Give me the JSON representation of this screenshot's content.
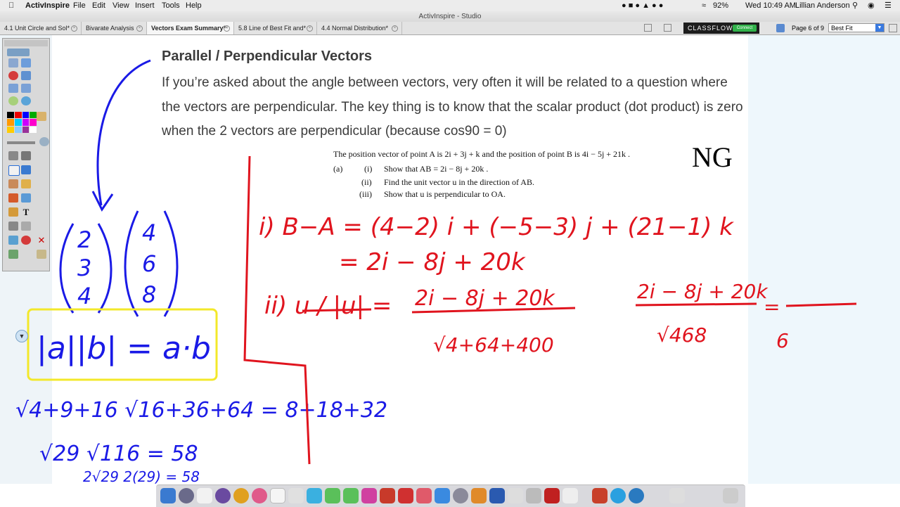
{
  "menubar": {
    "apple": "",
    "app_name": "ActivInspire",
    "items": [
      "File",
      "Edit",
      "View",
      "Insert",
      "Tools",
      "Help"
    ],
    "battery": "92%",
    "clock": "Wed 10:49 AM",
    "user": "Lillian Anderson"
  },
  "window": {
    "title": "ActivInspire - Studio"
  },
  "tabs": [
    {
      "label": "4.1 Unit Circle and Sol*"
    },
    {
      "label": "Bivarate Analysis"
    },
    {
      "label": "Vectors Exam Summary*"
    },
    {
      "label": "5.8 Line of Best Fit and*"
    },
    {
      "label": "4.4 Normal Distribution*"
    }
  ],
  "toolbar": {
    "classflow": "CLASSFLOW",
    "connect": "Connect",
    "page_indicator": "Page 6 of 9",
    "zoom": "Best Fit"
  },
  "content": {
    "heading": "Parallel / Perpendicular Vectors",
    "paragraph": "If you’re asked about the angle between vectors, very often it will be related to a question where the vectors are perpendicular. The key thing is to know that the scalar product (dot product) is zero when the 2 vectors are perpendicular (because cos90 = 0)",
    "question": {
      "intro": "The position vector of point A is 2i + 3j + k  and the position of point B is 4i − 5j + 21k .",
      "a_label": "(a)",
      "i_label": "(i)",
      "i_text": "Show that  AB = 2i − 8j + 20k .",
      "ii_label": "(ii)",
      "ii_text": "Find the unit vector u in the direction of AB.",
      "iii_label": "(iii)",
      "iii_text": "Show that u is perpendicular to OA."
    },
    "ng_mark": "NG"
  },
  "handwriting": {
    "col1": [
      "2",
      "3",
      "4"
    ],
    "col2": [
      "4",
      "6",
      "8"
    ],
    "boxed_formula": "|a||b| = a·b",
    "sqrt_line": "√4+9+16 √16+36+64 = 8+18+32",
    "line2": "√29  √116  =  58",
    "line3": "2√29   2(29) = 58",
    "step_i_1": "i) B−A = (4−2) i + (−5−3) j + (21−1) k",
    "step_i_2": "= 2i − 8j + 20k",
    "step_ii_lhs": "ii)  u / |u|  =",
    "step_ii_num": "2i − 8j + 20k",
    "step_ii_den": "√4+64+400",
    "step_ii_num2": "2i − 8j + 20k",
    "step_ii_den2": "√468",
    "step_ii_eq": "=",
    "step_ii_den3": "6"
  },
  "colors": {
    "blue_ink": "#1a1ae6",
    "red_ink": "#e0141e",
    "yellow_ink": "#f3e82a"
  }
}
